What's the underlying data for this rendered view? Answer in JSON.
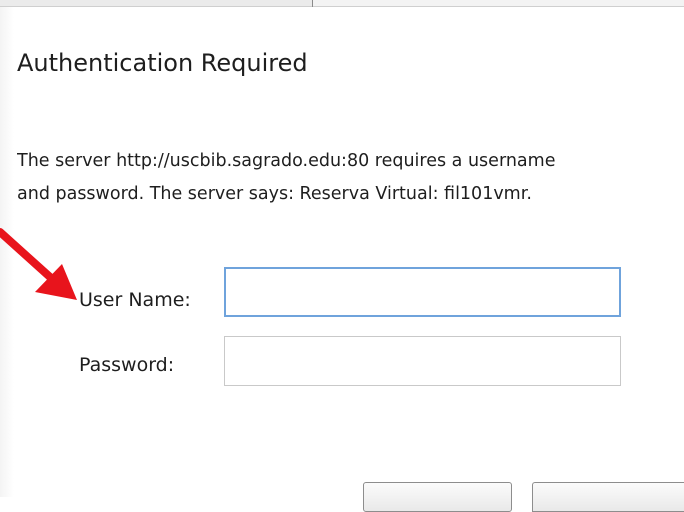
{
  "dialog": {
    "title": "Authentication Required",
    "message_line1": "The server http://uscbib.sagrado.edu:80 requires a username",
    "message_line2": "and password. The server says: Reserva Virtual: fil101vmr.",
    "username_label": "User Name:",
    "username_value": "",
    "password_label": "Password:",
    "password_value": "",
    "ok_label": "",
    "cancel_label": ""
  },
  "annotation": {
    "icon": "red-arrow-icon",
    "color": "#e8141c"
  },
  "colors": {
    "focus_border": "#6fa3dc",
    "input_border": "#c9c9c9",
    "text": "#1e1e1e"
  }
}
